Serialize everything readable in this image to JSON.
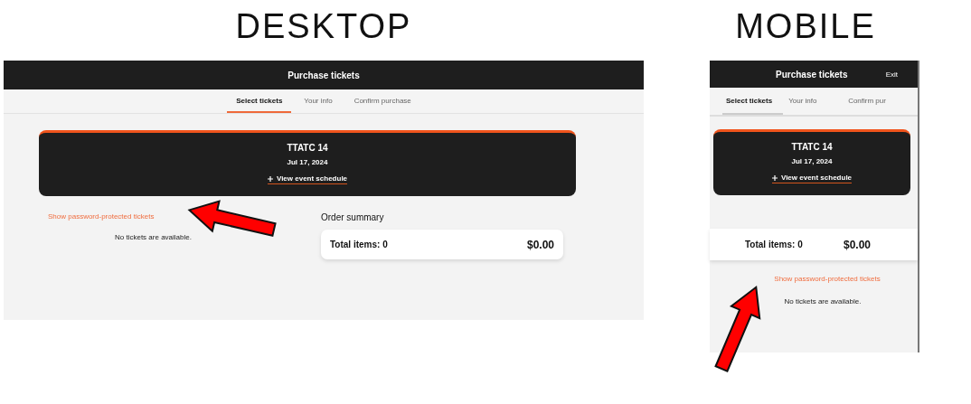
{
  "views": [
    {
      "kind": "desktop",
      "heading": "DESKTOP",
      "header": {
        "title": "Purchase tickets"
      },
      "tabs": [
        {
          "label": "Select tickets",
          "selected": true
        },
        {
          "label": "Your info",
          "selected": false
        },
        {
          "label": "Confirm purchase",
          "selected": false
        }
      ],
      "event": {
        "name": "TTATC 14",
        "date": "Jul 17, 2024",
        "schedule_link": "View event schedule"
      },
      "password_link": "Show password-protected tickets",
      "empty_message": "No tickets are available.",
      "order_summary": {
        "title": "Order summary",
        "total_label": "Total items: 0",
        "total_amount": "$0.00"
      }
    },
    {
      "kind": "mobile",
      "heading": "MOBILE",
      "header": {
        "title": "Purchase tickets",
        "exit": "Exit"
      },
      "tabs": [
        {
          "label": "Select tickets",
          "selected": true
        },
        {
          "label": "Your info",
          "selected": false
        },
        {
          "label": "Confirm pur",
          "selected": false
        }
      ],
      "event": {
        "name": "TTATC 14",
        "date": "Jul 17, 2024",
        "schedule_link": "View event schedule"
      },
      "password_link": "Show password-protected tickets",
      "empty_message": "No tickets are available.",
      "order_summary": {
        "total_label": "Total items: 0",
        "total_amount": "$0.00"
      }
    }
  ]
}
